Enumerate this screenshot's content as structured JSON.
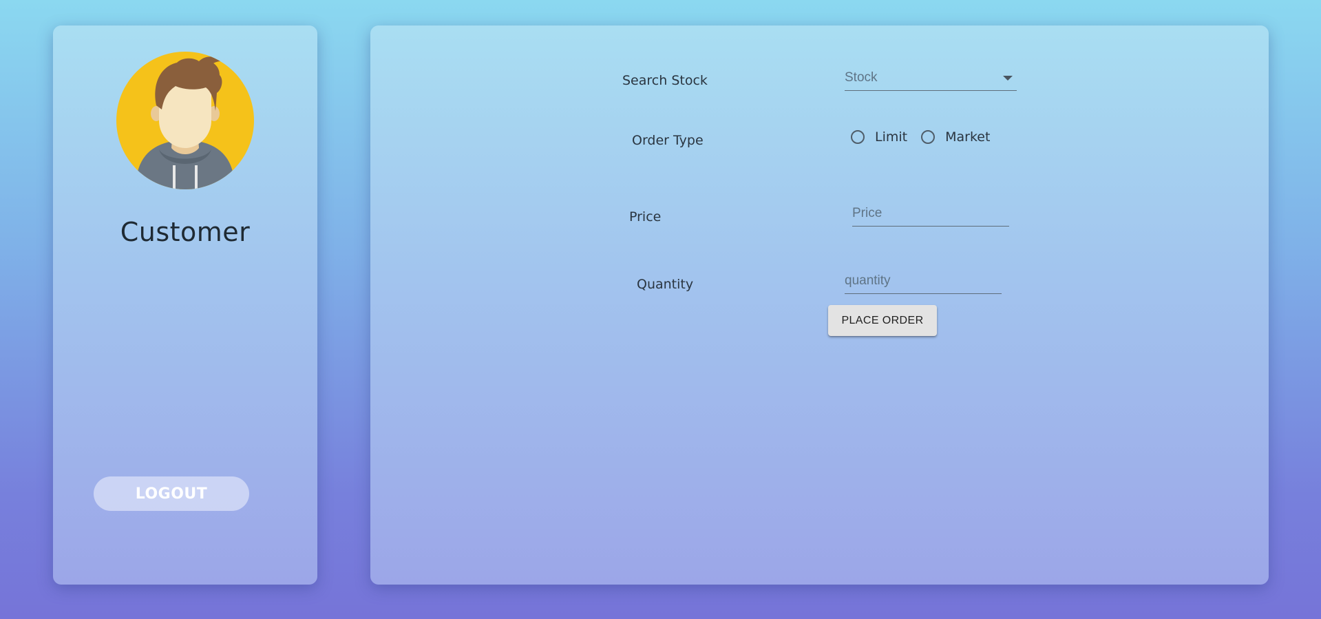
{
  "sidebar": {
    "user_name": "Customer",
    "logout_label": "LOGOUT"
  },
  "order_form": {
    "search_stock_label": "Search Stock",
    "stock_placeholder": "Stock",
    "order_type_label": "Order Type",
    "order_type_options": [
      "Limit",
      "Market"
    ],
    "price_label": "Price",
    "price_placeholder": "Price",
    "quantity_label": "Quantity",
    "quantity_placeholder": "quantity",
    "place_order_label": "PLACE ORDER"
  },
  "colors": {
    "background_top": "#8bd8f0",
    "background_bottom": "#7674d8",
    "avatar_bg": "#f5c21a",
    "button_bg": "#e3e3e3"
  }
}
